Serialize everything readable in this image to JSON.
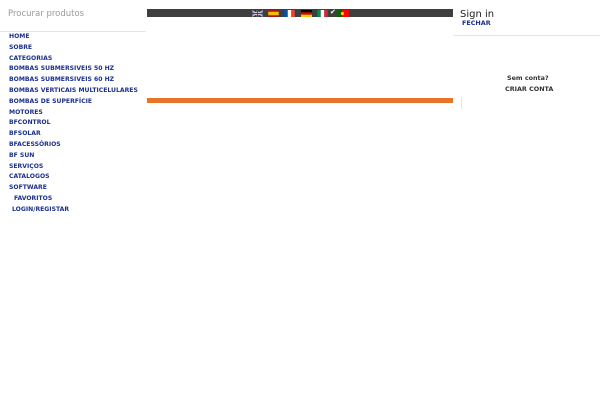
{
  "search": {
    "placeholder": "Procurar produtos"
  },
  "menu": {
    "items": [
      "HOME",
      "SOBRE",
      "CATEGORIAS",
      "BOMBAS SUBMERSIVEIS 50 HZ",
      "BOMBAS SUBMERSIVEIS 60 HZ",
      "BOMBAS VERTICAIS MULTICELULARES",
      "BOMBAS DE SUPERFÍCIE",
      "MOTORES",
      "BFCONTROL",
      "BFSOLAR",
      "BFACESSÓRIOS",
      "BF SUN",
      "SERVIÇOS",
      "CATALOGOS",
      "SOFTWARE",
      "FAVORITOS",
      "LOGIN/REGISTAR"
    ]
  },
  "languages": [
    {
      "code": "en",
      "icon": "uk-flag-icon"
    },
    {
      "code": "es",
      "icon": "spain-flag-icon"
    },
    {
      "code": "fr",
      "icon": "france-flag-icon"
    },
    {
      "code": "de",
      "icon": "germany-flag-icon"
    },
    {
      "code": "it",
      "icon": "italy-flag-icon"
    },
    {
      "code": "pt",
      "icon": "portugal-flag-icon",
      "selected": true
    }
  ],
  "account": {
    "title": "Sign in",
    "close": "FECHAR",
    "no_account": "Sem conta?",
    "create": "CRIAR CONTA"
  },
  "colors": {
    "menu_link": "#1a2f8f",
    "lang_bar": "#3f3f3f",
    "accent_bar": "#e8742a"
  }
}
